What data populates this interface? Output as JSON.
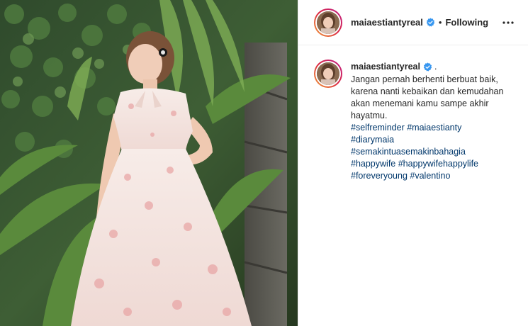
{
  "header": {
    "username": "maiaestiantyreal",
    "separator": "•",
    "follow_state": "Following",
    "more_icon": "more-horizontal-icon"
  },
  "caption": {
    "username": "maiaestiantyreal",
    "trailing_dot": ".",
    "text": "Jangan pernah berhenti berbuat baik,\nkarena nanti kebaikan dan kemudahan\nakan menemani kamu sampe akhir\nhayatmu.",
    "hashtag_lines": [
      [
        "#selfreminder",
        "#maiaestianty"
      ],
      [
        "#diarymaia"
      ],
      [
        "#semakintuasemakinbahagia"
      ],
      [
        "#happywife",
        "#happywifehappylife"
      ],
      [
        "#foreveryoung",
        "#valentino"
      ]
    ]
  },
  "colors": {
    "verified": "#3897f0",
    "hashtag": "#00376b",
    "ring": "#dc2743"
  }
}
